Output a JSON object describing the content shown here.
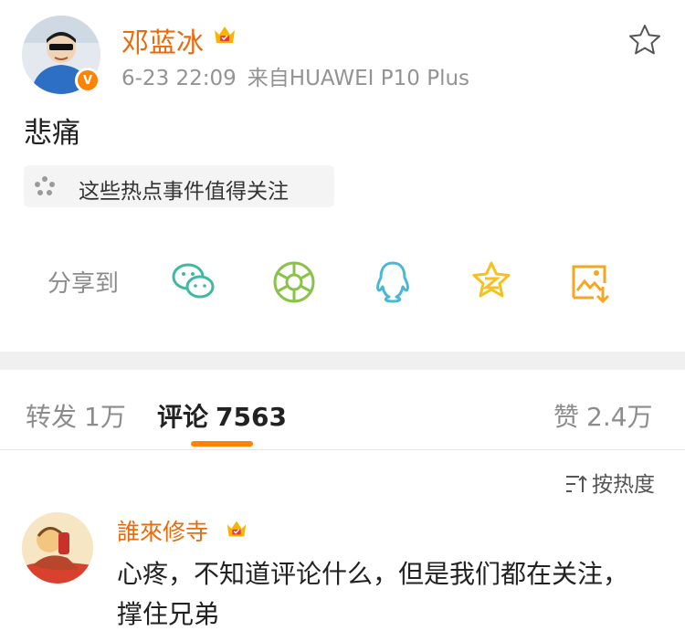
{
  "post": {
    "author": "邓蓝冰",
    "date": "6-23 22:09",
    "source": "来自HUAWEI P10 Plus",
    "content": "悲痛",
    "topic_chip": "这些热点事件值得关注",
    "share_label": "分享到",
    "share_targets": [
      "wechat-icon",
      "moments-icon",
      "qq-icon",
      "qzone-icon",
      "save-image-icon"
    ]
  },
  "tabs": {
    "repost_label": "转发",
    "repost_count": "1万",
    "comment_label": "评论",
    "comment_count": "7563",
    "like_label": "赞",
    "like_count": "2.4万"
  },
  "sort": {
    "label": "按热度"
  },
  "comment": {
    "author": "誰來修寺",
    "text": "心疼，不知道评论什么，但是我们都在关注，撑住兄弟"
  },
  "colors": {
    "accent": "#ff8200",
    "username": "#e86b0c",
    "wechat": "#3fb9a4",
    "moments": "#8bc34a",
    "qq": "#4ab7d6",
    "qzone": "#f5c120"
  }
}
